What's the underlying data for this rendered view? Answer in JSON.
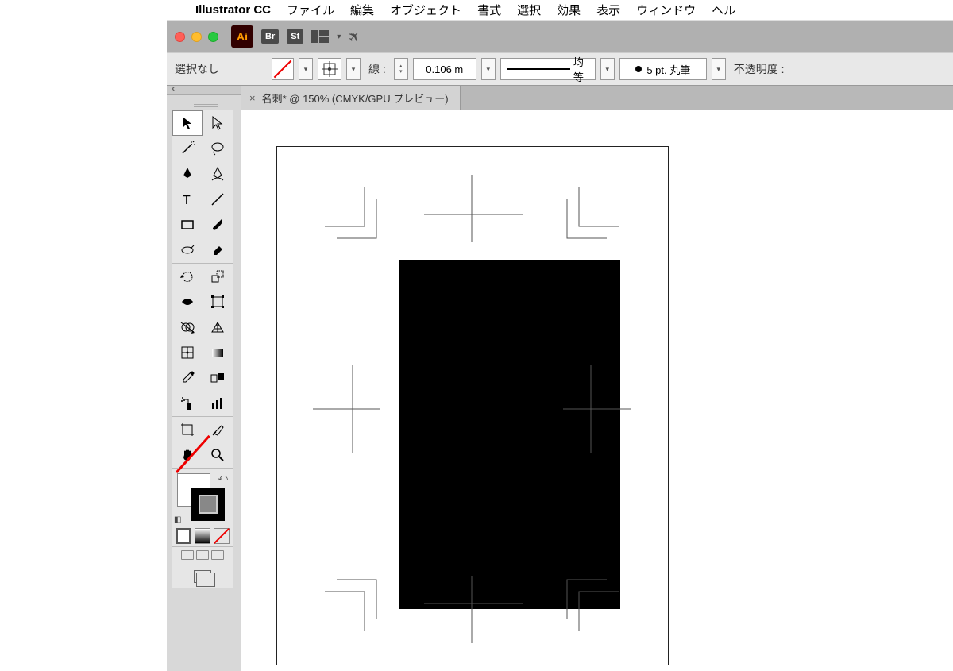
{
  "mac_menu": {
    "apple": "",
    "app": "Illustrator CC",
    "items": [
      "ファイル",
      "編集",
      "オブジェクト",
      "書式",
      "選択",
      "効果",
      "表示",
      "ウィンドウ",
      "ヘル"
    ]
  },
  "titlebar": {
    "app_icon": "Ai",
    "badges": [
      "Br",
      "St"
    ]
  },
  "controlbar": {
    "selection": "選択なし",
    "stroke_label": "線 :",
    "stroke_value": "0.106 m",
    "uniform": "均等",
    "brush": "5 pt. 丸筆",
    "opacity_label": "不透明度 :"
  },
  "doc_tab": {
    "close": "×",
    "title": "名刺* @ 150% (CMYK/GPU プレビュー)"
  },
  "tools": [
    "selection-tool",
    "direct-selection-tool",
    "magic-wand-tool",
    "lasso-tool",
    "pen-tool",
    "curvature-tool",
    "type-tool",
    "line-tool",
    "rectangle-tool",
    "paintbrush-tool",
    "shaper-tool",
    "eraser-tool",
    "rotate-tool",
    "scale-tool",
    "width-tool",
    "free-transform-tool",
    "shape-builder-tool",
    "perspective-tool",
    "mesh-tool",
    "gradient-tool",
    "eyedropper-tool",
    "blend-tool",
    "symbol-sprayer-tool",
    "column-graph-tool",
    "artboard-tool",
    "slice-tool",
    "hand-tool",
    "zoom-tool"
  ]
}
